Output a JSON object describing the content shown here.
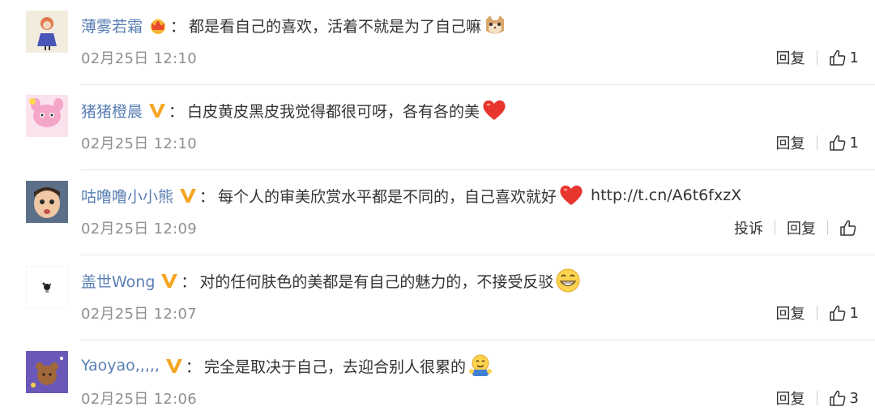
{
  "comments": [
    {
      "user": "薄雾若霜",
      "badge": "crown-icon",
      "colon": "：",
      "text": "都是看自己的喜欢，活着不就是为了自己嘛",
      "emoji": "cat-face-emoji-icon",
      "link": "",
      "time": "02月25日 12:10",
      "actions": [
        "回复"
      ],
      "likes": "1"
    },
    {
      "user": "猪猪橙晨",
      "badge": "v-badge-icon",
      "colon": "：",
      "text": "白皮黄皮黑皮我觉得都很可呀，各有各的美",
      "emoji": "red-heart-emoji-icon",
      "link": "",
      "time": "02月25日 12:10",
      "actions": [
        "回复"
      ],
      "likes": "1"
    },
    {
      "user": "咕噜噜小小熊",
      "badge": "v-badge-icon",
      "colon": "：",
      "text": "每个人的审美欣赏水平都是不同的，自己喜欢就好",
      "emoji": "red-heart-emoji-icon",
      "link": "http://t.cn/A6t6fxzX",
      "time": "02月25日 12:09",
      "actions": [
        "投诉",
        "回复"
      ],
      "likes": ""
    },
    {
      "user": "盖世Wong",
      "badge": "v-badge-icon",
      "colon": "：",
      "text": "对的任何肤色的美都是有自己的魅力的，不接受反驳",
      "emoji": "grin-face-emoji-icon",
      "link": "",
      "time": "02月25日 12:07",
      "actions": [
        "回复"
      ],
      "likes": "1"
    },
    {
      "user": "Yaoyao,,,,,",
      "badge": "v-badge-icon",
      "colon": "：",
      "text": "完全是取决于自己，去迎合别人很累的",
      "emoji": "hug-face-emoji-icon",
      "link": "",
      "time": "02月25日 12:06",
      "actions": [
        "回复"
      ],
      "likes": "3"
    }
  ],
  "colors": {
    "username": "#5a7fb5",
    "text": "#333333",
    "time": "#8f8f8f",
    "v_badge": "#f5a623",
    "divider": "#e6e6e6"
  }
}
